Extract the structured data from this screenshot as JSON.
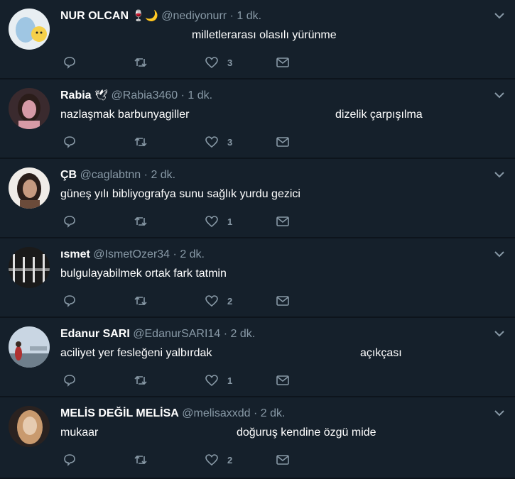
{
  "tweets": [
    {
      "name": "NUR OLCAN",
      "emoji": "🍷🌙",
      "handle": "@nediyonurr",
      "sep": "·",
      "time": "1 dk.",
      "text_parts": [
        "milletlerarası olasılı yürünme"
      ],
      "likes": "3",
      "avatar_colors": [
        "#e8eef2",
        "#9fc6e3",
        "#f5d04a"
      ]
    },
    {
      "name": "Rabia",
      "emoji": "🕊",
      "handle": "@Rabia3460",
      "sep": "·",
      "time": "1 dk.",
      "text_parts": [
        "nazlaşmak barbunyagiller",
        "dizelik çarpışılma"
      ],
      "likes": "3",
      "avatar_colors": [
        "#3a2a2e",
        "#d69aa6",
        "#2b1d1a"
      ]
    },
    {
      "name": "ÇB",
      "emoji": "",
      "handle": "@caglabtnn",
      "sep": "·",
      "time": "2 dk.",
      "text_parts": [
        "güneş yılı bibliyografya sunu sağlık yurdu gezici"
      ],
      "likes": "1",
      "avatar_colors": [
        "#f0ece8",
        "#6b4b3a",
        "#2a1e1a"
      ]
    },
    {
      "name": "ısmet",
      "emoji": "",
      "handle": "@IsmetOzer34",
      "sep": "·",
      "time": "2 dk.",
      "text_parts": [
        "bulgulayabilmek ortak fark tatmin"
      ],
      "likes": "2",
      "avatar_colors": [
        "#1a1a1a",
        "#8a8a8a",
        "#e0e0e0"
      ]
    },
    {
      "name": "Edanur SARI",
      "emoji": "",
      "handle": "@EdanurSARI14",
      "sep": "·",
      "time": "2 dk.",
      "text_parts": [
        "aciliyet yer fesleğeni yalbırdak",
        "açıkçası"
      ],
      "likes": "1",
      "avatar_colors": [
        "#c9d6e3",
        "#6f7f8c",
        "#b03030"
      ]
    },
    {
      "name": "MELİS DEĞİL MELİSA",
      "emoji": "",
      "handle": "@melisaxxdd",
      "sep": "·",
      "time": "2 dk.",
      "text_parts": [
        "mukaar",
        "doğuruş kendine özgü mide"
      ],
      "likes": "2",
      "avatar_colors": [
        "#2a2220",
        "#c99a6e",
        "#e6cbb0"
      ]
    }
  ],
  "icons": {
    "reply": "reply-icon",
    "retweet": "retweet-icon",
    "like": "like-icon",
    "message": "message-icon",
    "caret": "chevron-down-icon"
  },
  "colors": {
    "background": "#15202b",
    "divider": "#0d141c",
    "muted": "#8899a6",
    "text": "#ffffff"
  }
}
